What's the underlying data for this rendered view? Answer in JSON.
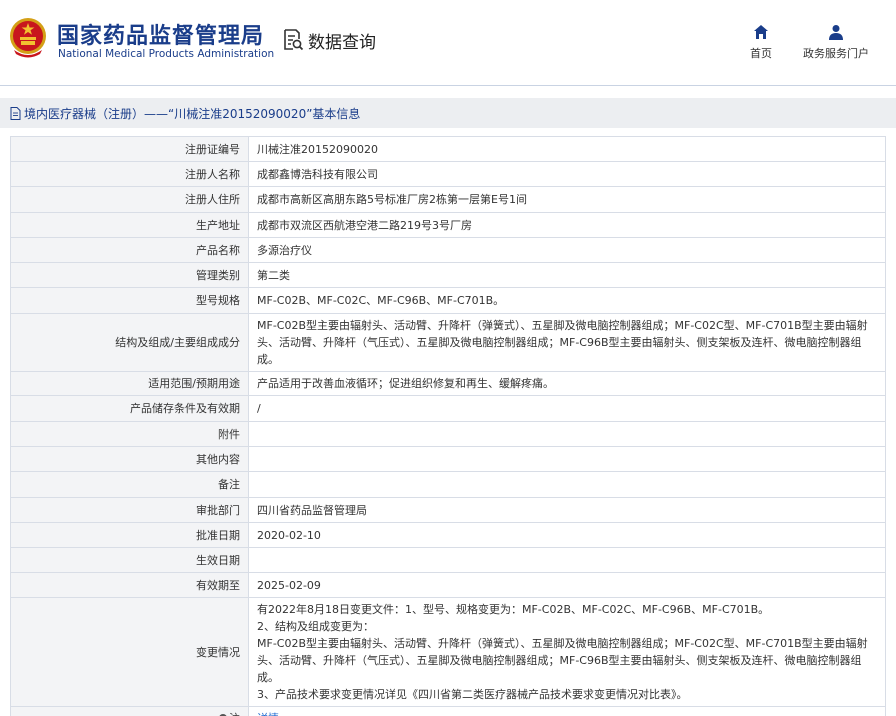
{
  "header": {
    "org_name_cn": "国家药品监督管理局",
    "org_name_en": "National Medical Products Administration",
    "query_label": "数据查询",
    "nav": [
      {
        "label": "首页",
        "icon": "home-icon"
      },
      {
        "label": "政务服务门户",
        "icon": "user-icon"
      }
    ]
  },
  "breadcrumb": {
    "text": "境内医疗器械（注册）——“川械注准20152090020”基本信息",
    "icon": "document-icon"
  },
  "colors": {
    "brand_blue": "#1a3d8a",
    "link_blue": "#1e6ad2",
    "label_bg": "#f3f4f6",
    "crumb_bg": "#eceef1",
    "border": "#d8dde6"
  },
  "rows": [
    {
      "label": "注册证编号",
      "value": [
        "川械注准20152090020"
      ]
    },
    {
      "label": "注册人名称",
      "value": [
        "成都鑫博浩科技有限公司"
      ]
    },
    {
      "label": "注册人住所",
      "value": [
        "成都市高新区高朋东路5号标准厂房2栋第一层第E号1间"
      ]
    },
    {
      "label": "生产地址",
      "value": [
        "成都市双流区西航港空港二路219号3号厂房"
      ]
    },
    {
      "label": "产品名称",
      "value": [
        "多源治疗仪"
      ]
    },
    {
      "label": "管理类别",
      "value": [
        "第二类"
      ]
    },
    {
      "label": "型号规格",
      "value": [
        "MF-C02B、MF-C02C、MF-C96B、MF-C701B。"
      ]
    },
    {
      "label": "结构及组成/主要组成成分",
      "value": [
        "MF-C02B型主要由辐射头、活动臂、升降杆（弹簧式）、五星脚及微电脑控制器组成；MF-C02C型、MF-C701B型主要由辐射头、活动臂、升降杆（气压式）、五星脚及微电脑控制器组成；MF-C96B型主要由辐射头、侧支架板及连杆、微电脑控制器组成。"
      ]
    },
    {
      "label": "适用范围/预期用途",
      "value": [
        "产品适用于改善血液循环；促进组织修复和再生、缓解疼痛。"
      ]
    },
    {
      "label": "产品储存条件及有效期",
      "value": [
        "/"
      ]
    },
    {
      "label": "附件",
      "value": [
        ""
      ]
    },
    {
      "label": "其他内容",
      "value": [
        ""
      ]
    },
    {
      "label": "备注",
      "value": [
        ""
      ]
    },
    {
      "label": "审批部门",
      "value": [
        "四川省药品监督管理局"
      ]
    },
    {
      "label": "批准日期",
      "value": [
        "2020-02-10"
      ]
    },
    {
      "label": "生效日期",
      "value": [
        ""
      ]
    },
    {
      "label": "有效期至",
      "value": [
        "2025-02-09"
      ]
    },
    {
      "label": "变更情况",
      "value": [
        "有2022年8月18日变更文件：1、型号、规格变更为：MF-C02B、MF-C02C、MF-C96B、MF-C701B。",
        "2、结构及组成变更为：",
        "MF-C02B型主要由辐射头、活动臂、升降杆（弹簧式）、五星脚及微电脑控制器组成；MF-C02C型、MF-C701B型主要由辐射头、活动臂、升降杆（气压式）、五星脚及微电脑控制器组成；MF-C96B型主要由辐射头、侧支架板及连杆、微电脑控制器组成。",
        "3、产品技术要求变更情况详见《四川省第二类医疗器械产品技术要求变更情况对比表》。"
      ]
    },
    {
      "label": "注",
      "value": [
        "详情"
      ],
      "link": true
    }
  ]
}
